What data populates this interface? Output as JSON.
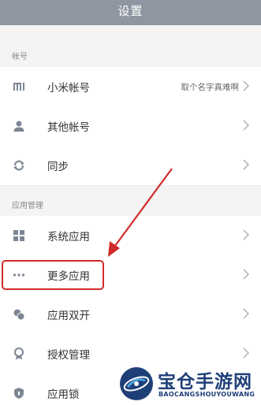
{
  "header": {
    "title": "设置"
  },
  "sections": {
    "account": {
      "title": "帐号",
      "items": [
        {
          "label": "小米帐号",
          "value": "取个名字真难啊",
          "icon": "mi-logo-icon"
        },
        {
          "label": "其他帐号",
          "icon": "person-icon"
        },
        {
          "label": "同步",
          "icon": "sync-icon"
        }
      ]
    },
    "apps": {
      "title": "应用管理",
      "items": [
        {
          "label": "系统应用",
          "icon": "grid-icon"
        },
        {
          "label": "更多应用",
          "icon": "more-dots-icon"
        },
        {
          "label": "应用双开",
          "icon": "dual-app-icon"
        },
        {
          "label": "授权管理",
          "icon": "badge-icon"
        },
        {
          "label": "应用锁",
          "icon": "shield-lock-icon"
        }
      ]
    }
  },
  "annotation": {
    "highlight_color": "#d12a2a",
    "arrow_color": "#d12a2a"
  },
  "watermark": {
    "text": "宝仓手游网",
    "subtext": "BAOCANGSHOUYOUWANG"
  },
  "colors": {
    "titlebar": "#8e97a1",
    "icon": "#7d8794",
    "background": "#f4f4f4"
  }
}
